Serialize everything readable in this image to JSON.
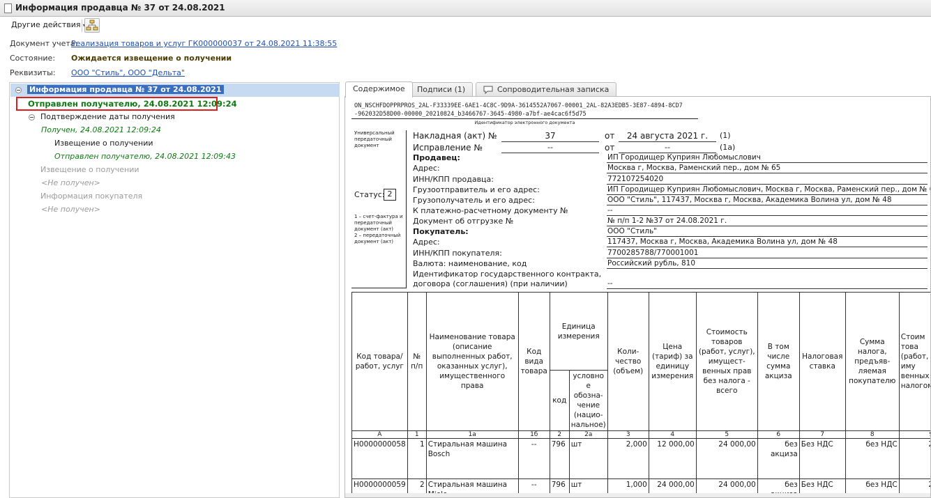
{
  "window": {
    "title": "Информация продавца № 37 от 24.08.2021"
  },
  "toolbar": {
    "actions_label": "Другие действия",
    "actions_arrow": "▾"
  },
  "fields": {
    "doc_label": "Документ учета:",
    "doc_value": "Реализация товаров и услуг ГК000000037 от 24.08.2021 11:38:55",
    "state_label": "Состояние:",
    "state_value": "Ожидается извещение о получении",
    "req_label": "Реквизиты:",
    "req_value": "ООО \"Стиль\", ООО \"Дельта\""
  },
  "tree": {
    "root": "Информация продавца № 37 от 24.08.2021",
    "sent": "Отправлен получателю, 24.08.2021 12:09:24",
    "confirm": "Подтверждение даты получения",
    "received": "Получен, 24.08.2021 12:09:24",
    "notice": "Извещение о получении",
    "notice_sent": "Отправлен получателю, 24.08.2021 12:09:43",
    "notice2": "Извещение о получении",
    "notice2_status": "<Не получен>",
    "buyer_info": "Информация покупателя",
    "buyer_status": "<Не получен>"
  },
  "tabs": [
    "Содержимое",
    "Подписи (1)",
    "Сопроводительная записка"
  ],
  "doc": {
    "id1": "ON_NSCHFDOPPRPROS_2AL-F33339EE-6AE1-4C8C-9D9A-3614552A7067-00001_2AL-82A3EDB5-3E87-4894-8CD7",
    "id2": "-962032D58D00-00000_20210824_b3466767-3645-4980-a7bf-ae4cac6f5d75",
    "id_caption": "Идентификатор электронного документа",
    "side1": [
      "Универсальный",
      "передаточный",
      "документ"
    ],
    "status_label": "Статус:",
    "status_value": "2",
    "side2": [
      "1 – счет-фактура и",
      "передаточный",
      "документ (акт)",
      "2 – передаточный",
      "документ (акт)"
    ],
    "invoice_label": "Накладная (акт) №",
    "invoice_no": "37",
    "ot": "от",
    "invoice_date": "24 августа 2021 г.",
    "n1": "(1)",
    "fix_label": "Исправление №",
    "fix_no": "--",
    "fix_ot": "от",
    "fix_date": "--",
    "n1a": "(1а)",
    "rows": [
      {
        "label": "Продавец:",
        "value": "ИП Городищер Куприян Любомыслович",
        "bold": true
      },
      {
        "label": "Адрес:",
        "value": "Москва г, Москва, Раменский пер., дом № 65"
      },
      {
        "label": "ИНН/КПП продавца:",
        "value": "772107254020"
      },
      {
        "label": "Грузоотправитель и его адрес:",
        "value": "ИП Городищер Куприян Любомыслович, Москва г, Москва, Раменский пер., дом № 65"
      },
      {
        "label": "Грузополучатель и его адрес:",
        "value": "ООО \"Стиль\", 117437, Москва г, Москва, Академика Волина ул, дом № 48"
      },
      {
        "label": "К платежно-расчетному документу №",
        "value": "--"
      },
      {
        "label": "Документ об отгрузке №",
        "value": "№ п/п 1-2 №37 от 24.08.2021 г."
      },
      {
        "label": "Покупатель:",
        "value": "ООО \"Стиль\"",
        "bold": true
      },
      {
        "label": "Адрес:",
        "value": "117437, Москва г, Москва, Академика Волина ул, дом № 48"
      },
      {
        "label": "ИНН/КПП покупателя:",
        "value": "7700285788/770001001"
      },
      {
        "label": "Валюта: наименование, код",
        "value": "Российский рубль, 810"
      }
    ],
    "gov_label1": "Идентификатор государственного контракта,",
    "gov_label2": "договора (соглашения) (при наличии)",
    "gov_value": "--"
  },
  "table": {
    "h": {
      "code": "Код товара/ работ, услуг",
      "num": "№ п/п",
      "name": "Наименование товара (описание выполненных работ, оказанных услуг), имущественного права",
      "kind": "Код вида товара",
      "unit": "Единица измерения",
      "unit_code": "код",
      "unit_name": "условно е обозна- чение (нацио- нальное)",
      "qty": "Коли- чество (объем)",
      "price": "Цена (тариф) за единицу измерения",
      "cost": "Стоимость товаров (работ, услуг), имущест- венных прав без налога - всего",
      "excise": "В том числе сумма акциза",
      "rate": "Налоговая ставка",
      "tax": "Сумма налога, предъяв- ляемая покупателю",
      "total": "Стоим това (работ, иму венных налогом"
    },
    "idx": [
      "А",
      "1",
      "1а",
      "1б",
      "2",
      "2а",
      "3",
      "4",
      "5",
      "6",
      "7",
      "8",
      "9"
    ],
    "rows": [
      {
        "code": "Н0000000058",
        "num": "1",
        "name": "Стиральная машина Bosch",
        "kind": "--",
        "ucode": "796",
        "uname": "шт",
        "qty": "2,000",
        "price": "12 000,00",
        "cost": "24 000,00",
        "excise": "без акциза",
        "rate": "Без НДС",
        "tax": "без НДС",
        "total": "2"
      },
      {
        "code": "Н0000000059",
        "num": "2",
        "name": "Стиральная машина Miele",
        "kind": "--",
        "ucode": "796",
        "uname": "шт",
        "qty": "1,000",
        "price": "24 000,00",
        "cost": "24 000,00",
        "excise": "без акциза",
        "rate": "Без НДС",
        "tax": "без НДС",
        "total": "2"
      }
    ]
  },
  "colors": {
    "selection": "#c6dbf2",
    "sent_green": "#0d7a12",
    "highlight_red": "#e21b1b",
    "link": "#1f4fb4"
  }
}
